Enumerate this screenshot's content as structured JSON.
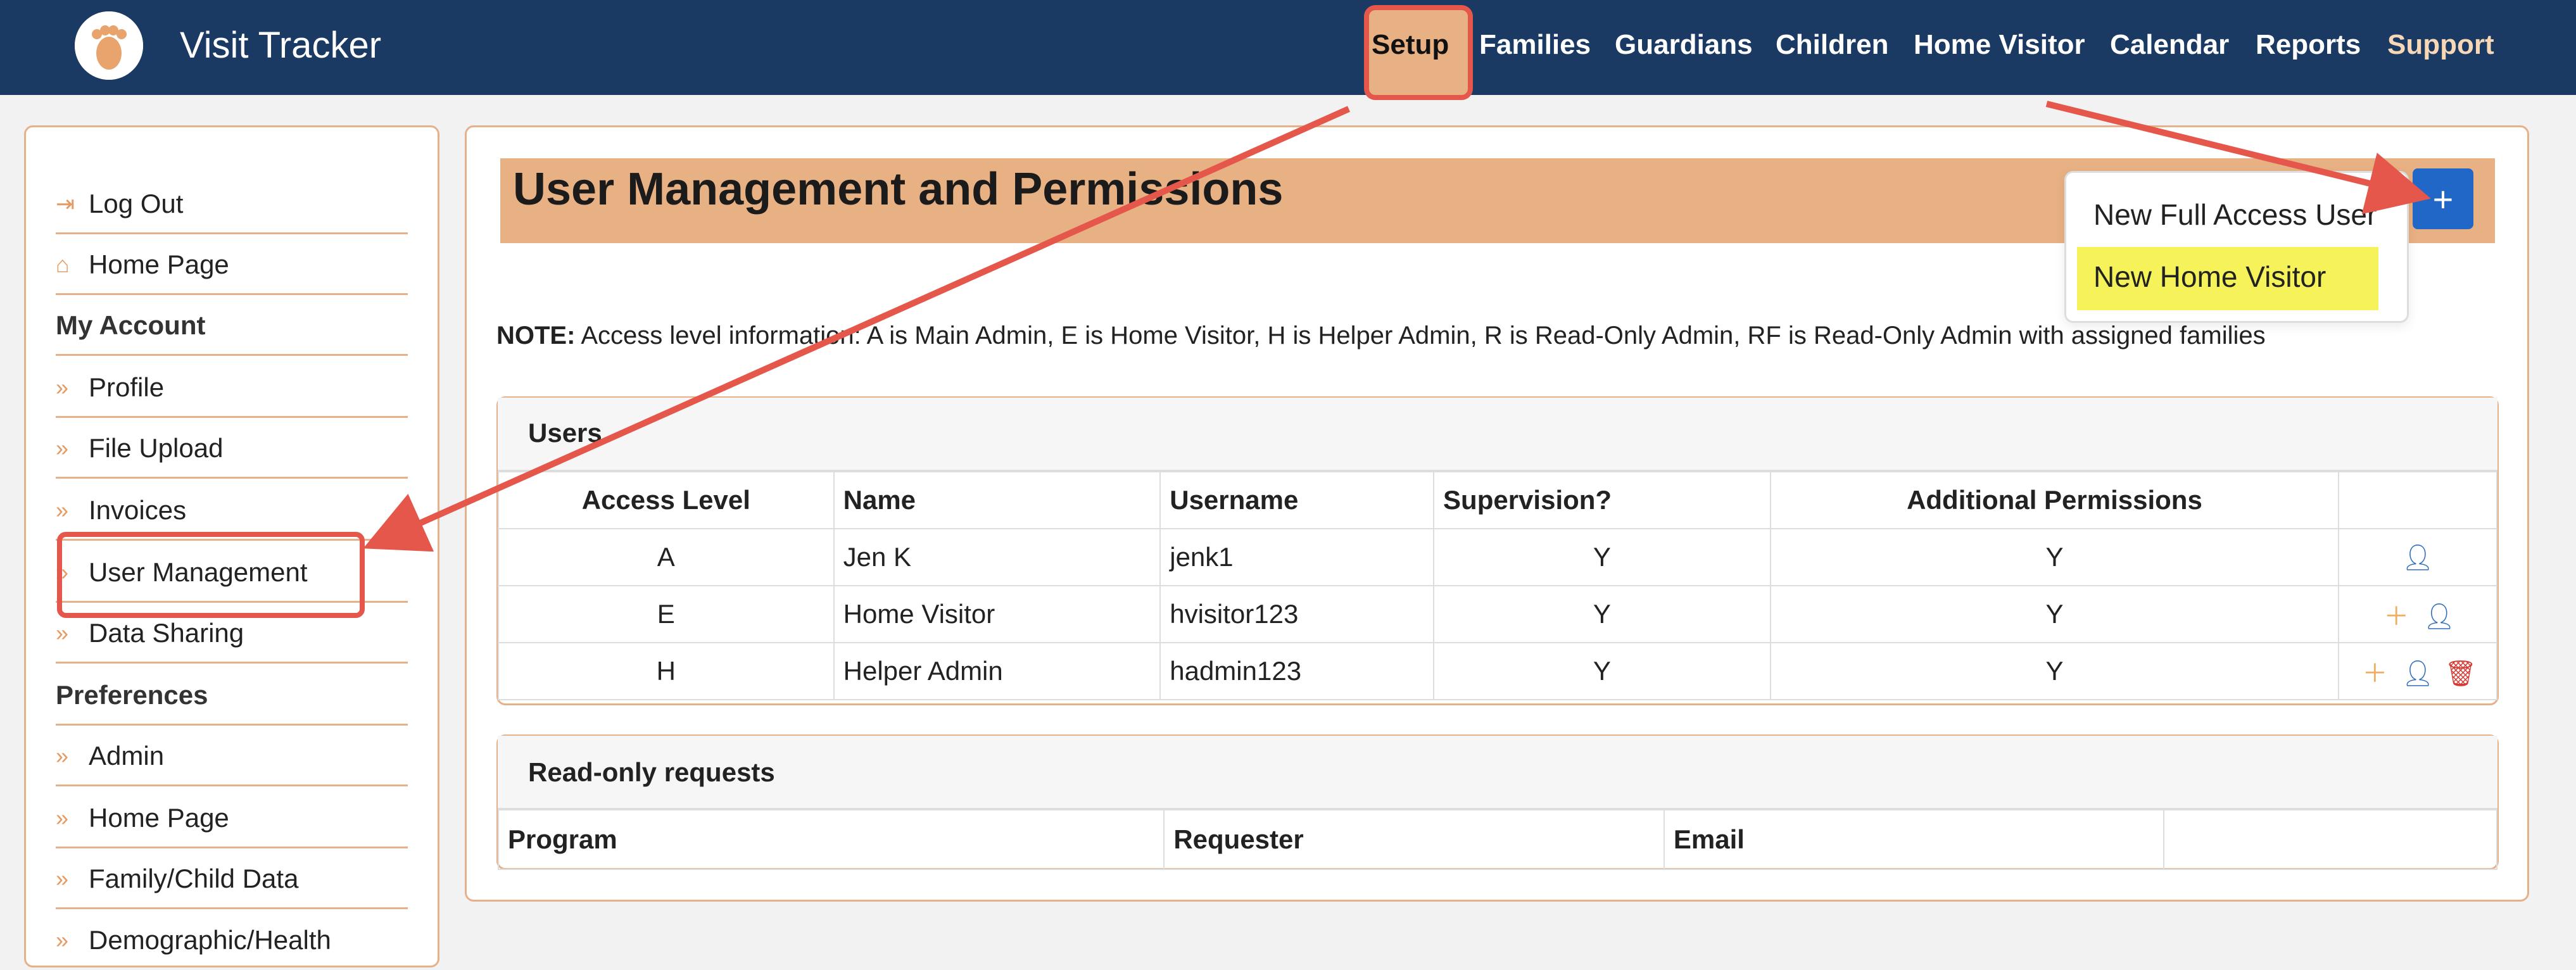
{
  "app": {
    "title": "Visit Tracker"
  },
  "nav": {
    "items": [
      "Setup",
      "Families",
      "Guardians",
      "Children",
      "Home Visitor",
      "Calendar",
      "Reports",
      "Support"
    ]
  },
  "sidebar": {
    "rows": [
      {
        "type": "link",
        "icon": "logout-icon",
        "label": "Log Out"
      },
      {
        "type": "link",
        "icon": "home-icon",
        "label": "Home Page"
      },
      {
        "type": "section",
        "label": "My Account"
      },
      {
        "type": "link",
        "icon": "chevron-right-icon",
        "label": "Profile"
      },
      {
        "type": "link",
        "icon": "chevron-right-icon",
        "label": "File Upload"
      },
      {
        "type": "link",
        "icon": "chevron-right-icon",
        "label": "Invoices"
      },
      {
        "type": "link",
        "icon": "chevron-right-icon",
        "label": "User Management"
      },
      {
        "type": "link",
        "icon": "chevron-right-icon",
        "label": "Data Sharing"
      },
      {
        "type": "section",
        "label": "Preferences"
      },
      {
        "type": "link",
        "icon": "chevron-right-icon",
        "label": "Admin"
      },
      {
        "type": "link",
        "icon": "chevron-right-icon",
        "label": "Home Page"
      },
      {
        "type": "link",
        "icon": "chevron-right-icon",
        "label": "Family/Child Data"
      },
      {
        "type": "link",
        "icon": "chevron-right-icon",
        "label": "Demographic/Health"
      }
    ]
  },
  "main": {
    "title": "User Management and Permissions",
    "add_label": "+",
    "dropdown": {
      "full_access": "New Full Access User",
      "home_visitor": "New Home Visitor"
    },
    "note_label": "NOTE:",
    "note_text": "Access level information: A is Main Admin, E is Home Visitor, H is Helper Admin, R is Read-Only Admin, RF is Read-Only Admin with assigned families"
  },
  "users": {
    "title": "Users",
    "columns": [
      "Access Level",
      "Name",
      "Username",
      "Supervision?",
      "Additional Permissions",
      ""
    ],
    "rows": [
      {
        "access": "A",
        "name": "Jen K",
        "username": "jenk1",
        "supervision": "Y",
        "permissions": "Y",
        "actions": [
          "user-icon"
        ]
      },
      {
        "access": "E",
        "name": "Home Visitor",
        "username": "hvisitor123",
        "supervision": "Y",
        "permissions": "Y",
        "actions": [
          "plus-icon",
          "user-icon"
        ]
      },
      {
        "access": "H",
        "name": "Helper Admin",
        "username": "hadmin123",
        "supervision": "Y",
        "permissions": "Y",
        "actions": [
          "plus-icon",
          "user-icon",
          "trash-icon"
        ]
      }
    ]
  },
  "readonly": {
    "title": "Read-only requests",
    "columns": [
      "Program",
      "Requester",
      "Email",
      ""
    ]
  },
  "colors": {
    "nav_bg": "#1b3a63",
    "accent": "#e8b184",
    "highlight_box": "#e4574a",
    "dropdown_highlight": "#f5f25a",
    "primary_button": "#2067c7"
  }
}
